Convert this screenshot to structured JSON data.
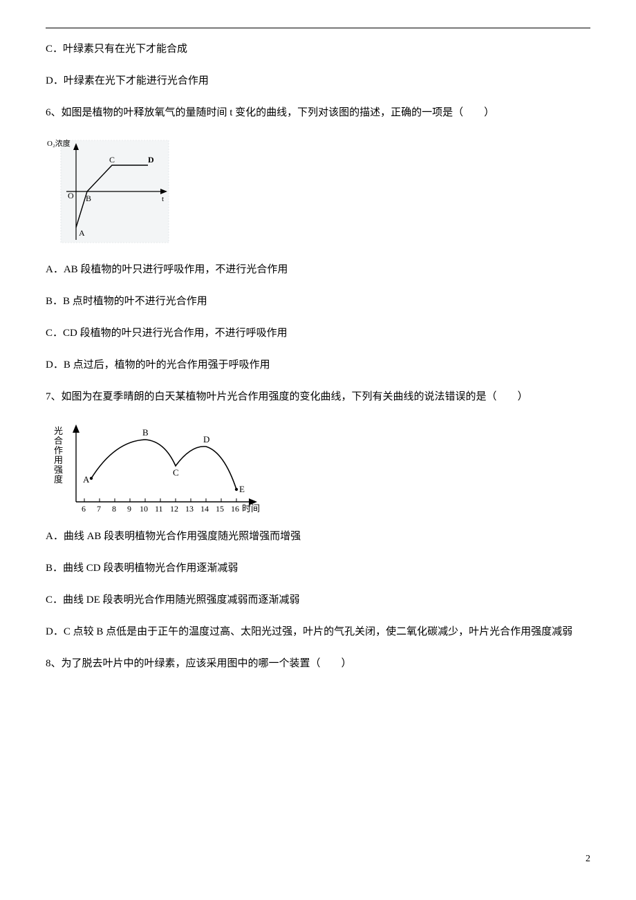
{
  "optionC_pre": "C．",
  "optionC_text": "叶绿素只有在光下才能合成",
  "optionD_pre": "D．",
  "optionD_text": "叶绿素在光下才能进行光合作用",
  "q6": {
    "stem": "6、如图是植物的叶释放氧气的量随时间 t 变化的曲线，下列对该图的描述，正确的一项是（　　）",
    "ylabel": "O₂浓度",
    "labels": {
      "A": "A",
      "B": "B",
      "C": "C",
      "D": "D",
      "O": "O",
      "t": "t"
    },
    "optA": "A．AB 段植物的叶只进行呼吸作用，不进行光合作用",
    "optB": "B．B 点时植物的叶不进行光合作用",
    "optC": "C．CD 段植物的叶只进行光合作用，不进行呼吸作用",
    "optD": "D．B 点过后，植物的叶的光合作用强于呼吸作用"
  },
  "q7": {
    "stem": "7、如图为在夏季晴朗的白天某植物叶片光合作用强度的变化曲线，下列有关曲线的说法错误的是（　　）",
    "ylabel": "光合作用强度",
    "xlabel": "时间",
    "ticks": [
      "6",
      "7",
      "8",
      "9",
      "10",
      "11",
      "12",
      "13",
      "14",
      "15",
      "16"
    ],
    "labels": {
      "A": "A",
      "B": "B",
      "C": "C",
      "D": "D",
      "E": "E"
    },
    "optA": "A．曲线 AB 段表明植物光合作用强度随光照增强而增强",
    "optB": "B．曲线 CD 段表明植物光合作用逐渐减弱",
    "optC": "C．曲线 DE 段表明光合作用随光照强度减弱而逐渐减弱",
    "optD": "D．C 点较 B 点低是由于正午的温度过高、太阳光过强，叶片的气孔关闭，使二氧化碳减少，叶片光合作用强度减弱"
  },
  "q8": {
    "stem": "8、为了脱去叶片中的叶绿素，应该采用图中的哪一个装置（　　）"
  },
  "page_number": "2",
  "chart_data": [
    {
      "type": "line",
      "title": "",
      "xlabel": "t",
      "ylabel": "O₂浓度",
      "series": [
        {
          "name": "O₂浓度",
          "points_labeled": [
            {
              "label": "A",
              "t": 0,
              "value": -3
            },
            {
              "label": "B",
              "t": 1,
              "value": 0
            },
            {
              "label": "C",
              "t": 3,
              "value": 3
            },
            {
              "label": "D",
              "t": 5,
              "value": 3
            }
          ]
        }
      ],
      "origin_label": "O",
      "note": "Qualitative curve; values are relative positions read from figure (no numeric axis shown)."
    },
    {
      "type": "line",
      "title": "",
      "xlabel": "时间",
      "ylabel": "光合作用强度",
      "x": [
        6,
        7,
        8,
        9,
        10,
        11,
        12,
        13,
        14,
        15,
        16
      ],
      "series": [
        {
          "name": "光合作用强度",
          "points_labeled": [
            {
              "label": "A",
              "x": 6.5,
              "y": 2.0
            },
            {
              "label": "B",
              "x": 10.0,
              "y": 5.0
            },
            {
              "label": "C",
              "x": 12.0,
              "y": 3.0
            },
            {
              "label": "D",
              "x": 14.0,
              "y": 4.5
            },
            {
              "label": "E",
              "x": 16.0,
              "y": 1.0
            }
          ]
        }
      ],
      "note": "No y-axis ticks shown; y-values are estimated relative heights."
    }
  ]
}
